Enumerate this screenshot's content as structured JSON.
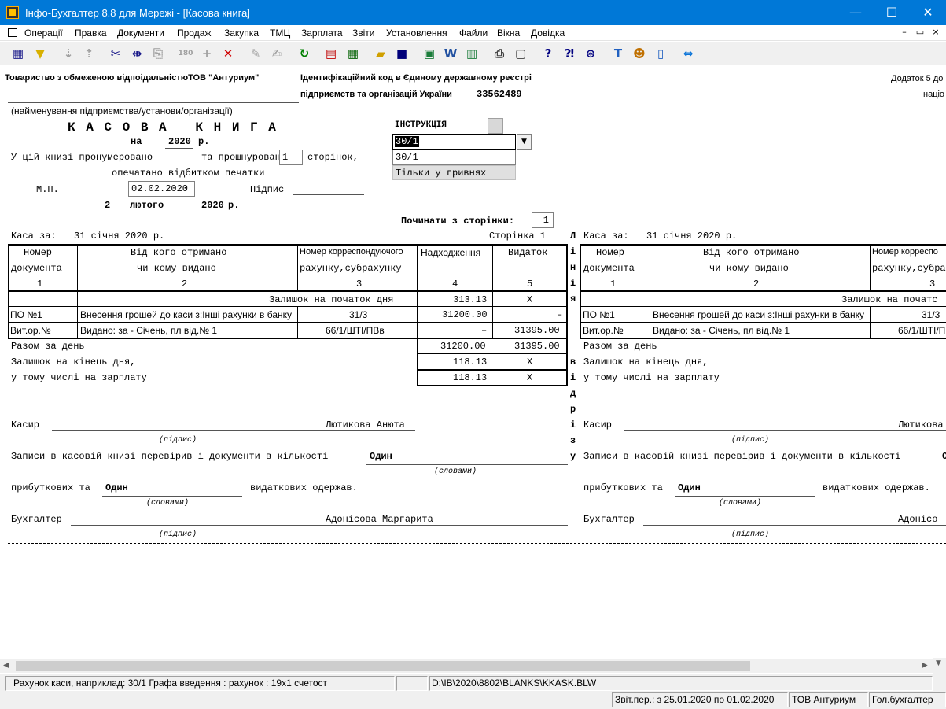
{
  "window": {
    "title": "Інфо-Бухгалтер 8.8 для Мережі - [Касова книга]",
    "minimize": "—",
    "maximize": "☐",
    "close": "✕"
  },
  "menu": [
    "Операції",
    "Правка",
    "Документи",
    "Продаж",
    "Закупка",
    "ТМЦ",
    "Зарплата",
    "Звіти",
    "Установлення",
    "Файли",
    "Вікна",
    "Довідка"
  ],
  "mdi_controls": [
    "–",
    "▭",
    "×"
  ],
  "header": {
    "company": "Товариство з обмеженою відпоідальністюТОВ \"Антуриум\"",
    "company_caption": "(найменування підприємства/установи/організації)",
    "id_label_1": "Ідентифікаційний код в Єдиному державному реєстрі",
    "id_label_2": "підприємств та організацій України",
    "id_code": "33562489",
    "appendix_1": "Додаток 5 до",
    "appendix_2": "націо"
  },
  "book": {
    "title": "К А С О В А   К Н И Г А",
    "year_prefix": "на",
    "year": "2020",
    "year_suffix": "р.",
    "numbered_label": "У цій книзі пронумеровано",
    "laced_label": "та прошнуровано",
    "pages_value": "1",
    "pages_suffix": "сторінок,",
    "sealed_label": "опечатано відбитком печатки",
    "mp_label": "М.П.",
    "date_value": "02.02.2020",
    "signature_label": "Підпис",
    "day": "2",
    "month": "лютого",
    "year2": "2020",
    "year2_suffix": "р."
  },
  "instruction": {
    "label": "ІНСТРУКЦІЯ",
    "account_value": "30/1",
    "account_echo": "30/1",
    "currency_mode": "Тільки у гривнях",
    "start_page_label": "Починати з сторінки:",
    "start_page_value": "1"
  },
  "sheet": {
    "cash_for_label": "Каса за:",
    "cash_for_date": "31 січня 2020 р.",
    "page_label": "Сторінка 1",
    "col_headers": {
      "c1a": "Номер",
      "c1b": "документа",
      "c2a": "Від кого отримано",
      "c2b": "чи кому видано",
      "c3a": "Номер корреспондуючого",
      "c3b": "рахунку,субрахунку",
      "c4": "Надходження",
      "c5": "Видаток"
    },
    "col_numbers": [
      "1",
      "2",
      "3",
      "4",
      "5"
    ],
    "balance_start_label": "Залишок на початок дня",
    "balance_start_in": "313.13",
    "balance_start_out": "X",
    "rows": [
      {
        "doc": "ПО №1",
        "who": "Внесення грошей до каси з:Інші рахунки в банку",
        "acct": "31/3",
        "in": "31200.00",
        "out": "–"
      },
      {
        "doc": "Вит.ор.№",
        "who": "Видано: за - Січень, пл від.№ 1",
        "acct": "66/1/ШТІ/ПВв",
        "in": "–",
        "out": "31395.00"
      }
    ],
    "day_total_label": "Разом за день",
    "day_total_in": "31200.00",
    "day_total_out": "31395.00",
    "balance_end_label": "Залишок на кінець дня,",
    "balance_end_in": "118.13",
    "balance_end_out": "X",
    "salary_label": "у тому числі на зарплату",
    "salary_in": "118.13",
    "salary_out": "X",
    "cashier_label": "Касир",
    "cashier_name": "Лютикова Анюта",
    "signature_caption": "(підпис)",
    "checked_label": "Записи в касовій книзі перевірив і документи в кількості",
    "checked_count": "Один",
    "words_caption": "(словами)",
    "incoming_label": "прибуткових та",
    "incoming_count": "Один",
    "outgoing_label": "видаткових одержав.",
    "accountant_label": "Бухгалтер",
    "accountant_name": "Адонісова Маргарита"
  },
  "sheet_right": {
    "cashier_name": "Лютикова",
    "checked_count": "О",
    "accountant_name": "Адонісо",
    "col3_cut": "Номер корреспо",
    "acct1_cut": "31/3",
    "acct2_cut": "66/1/ШТІ/П",
    "col3num": "3",
    "balance_cut": "Залишок на початс"
  },
  "fold_text": [
    "Л",
    "і",
    "н",
    "і",
    "я",
    "",
    "",
    "",
    "в",
    "і",
    "д",
    "р",
    "і",
    "з",
    "у"
  ],
  "status": {
    "hint": "Рахунок каси, наприклад: 30/1  Графа  введення : рахунок : 19х1  счетост",
    "file": "D:\\IB\\2020\\8802\\BLANKS\\KKASK.BLW",
    "period": "Звіт.пер.: з 25.01.2020 по 01.02.2020",
    "org": "ТОВ Антуриум",
    "role": "Гол.бухгалтер"
  }
}
